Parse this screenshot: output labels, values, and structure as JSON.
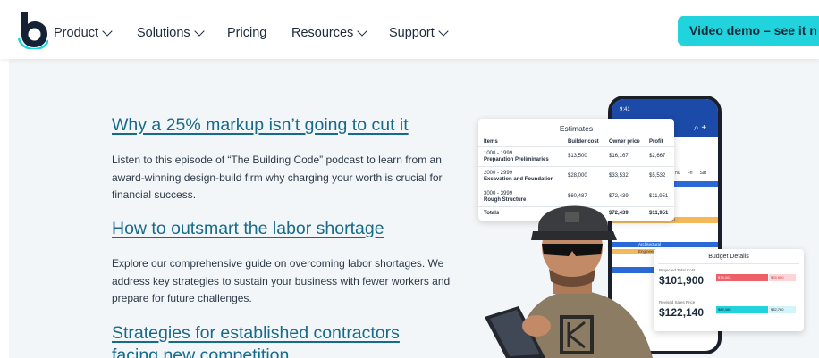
{
  "nav": {
    "items": [
      {
        "label": "Product",
        "has_dropdown": true
      },
      {
        "label": "Solutions",
        "has_dropdown": true
      },
      {
        "label": "Pricing",
        "has_dropdown": false
      },
      {
        "label": "Resources",
        "has_dropdown": true
      },
      {
        "label": "Support",
        "has_dropdown": true
      }
    ],
    "cta_label": "Video demo – see it n",
    "logo_icon": "buildertrend-b-logo",
    "colors": {
      "brand_dark": "#1d2a3b",
      "cta": "#20d3dc",
      "link": "#166a8a"
    }
  },
  "articles": [
    {
      "title": "Why a 25% markup isn’t going to cut it",
      "body": "Listen to this episode of “The Building Code” podcast to learn from an award-winning design-build firm why charging your worth is crucial for financial success."
    },
    {
      "title": "How to outsmart the labor shortage",
      "body": "Explore our comprehensive guide on overcoming labor shortages. We address key strategies to sustain your business with fewer workers and prepare for future challenges."
    },
    {
      "title": "Strategies for established contractors facing new competition",
      "body": ""
    }
  ],
  "estimates": {
    "title": "Estimates",
    "headers": [
      "Items",
      "Builder cost",
      "Owner price",
      "Profit"
    ],
    "rows": [
      {
        "code": "1000 - 1999",
        "name": "Preparation Preliminaries",
        "builder": "$13,500",
        "owner": "$16,167",
        "profit": "$2,667"
      },
      {
        "code": "2000 - 2999",
        "name": "Excavation and Foundation",
        "builder": "$28,000",
        "owner": "$33,532",
        "profit": "$5,532"
      },
      {
        "code": "3000 - 3999",
        "name": "Rough Structure",
        "builder": "$60,487",
        "owner": "$72,439",
        "profit": "$11,951"
      }
    ],
    "total": {
      "label": "Totals",
      "owner": "$72,439",
      "profit": "$11,951"
    }
  },
  "budget": {
    "title": "Budget Details",
    "projected_label": "Projected Total Cost",
    "projected_value": "$101,900",
    "revised_label": "Revised Sales Price",
    "revised_value": "$122,140",
    "bar1_left": "$76,003",
    "bar1_right": "$25,900",
    "bar2_left": "$89,380",
    "bar2_right": "$32,760"
  },
  "phone": {
    "time": "9:41",
    "schedule_labels": [
      "Architectural",
      "Landscaping Design",
      "Architectural",
      "Engineering Design"
    ],
    "days": [
      "Thu",
      "Fri",
      "Sat"
    ]
  }
}
